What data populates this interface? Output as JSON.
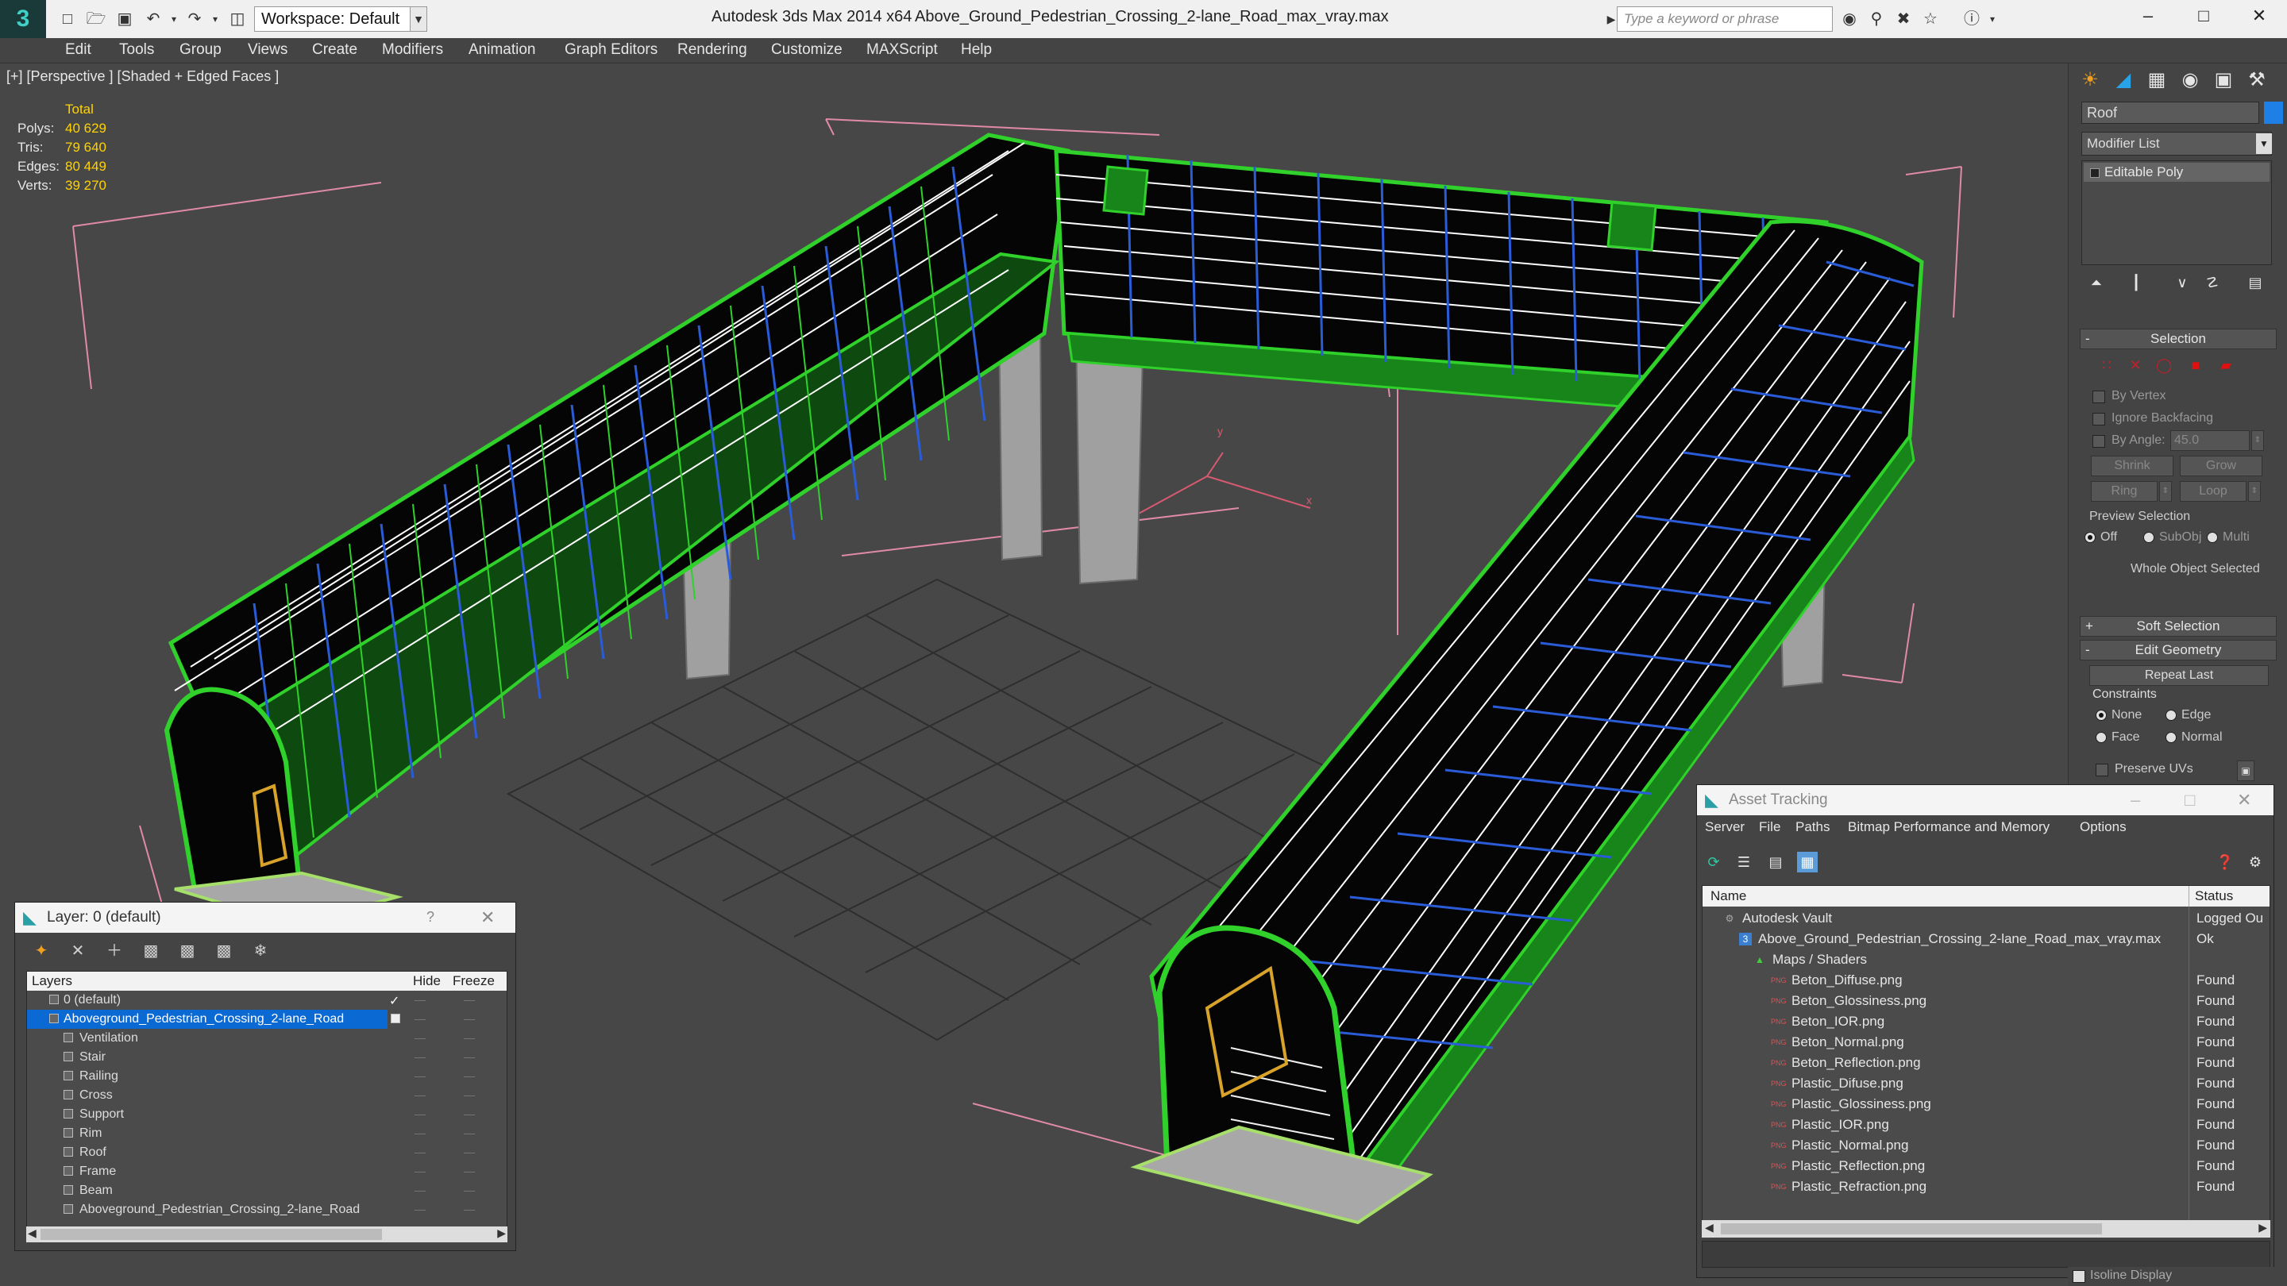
{
  "titlebar": {
    "app_title": "Autodesk 3ds Max 2014 x64",
    "file_title": "Above_Ground_Pedestrian_Crossing_2-lane_Road_max_vray.max",
    "workspace_label": "Workspace: Default",
    "search_placeholder": "Type a keyword or phrase"
  },
  "menu": [
    "Edit",
    "Tools",
    "Group",
    "Views",
    "Create",
    "Modifiers",
    "Animation",
    "Graph Editors",
    "Rendering",
    "Customize",
    "MAXScript",
    "Help"
  ],
  "viewport": {
    "label": "[+] [Perspective ] [Shaded + Edged Faces ]",
    "stats": {
      "total_label": "Total",
      "rows": [
        {
          "key": "Polys:",
          "value": "40 629"
        },
        {
          "key": "Tris:",
          "value": "79 640"
        },
        {
          "key": "Edges:",
          "value": "80 449"
        },
        {
          "key": "Verts:",
          "value": "39 270"
        }
      ]
    },
    "axis": {
      "x": "x",
      "y": "y"
    }
  },
  "command_panel": {
    "object_name": "Roof",
    "object_color": "#1e7fe6",
    "modifier_list": "Modifier List",
    "modifier_stack": [
      "Editable Poly"
    ],
    "selection": {
      "title": "Selection",
      "by_vertex": "By Vertex",
      "ignore_backfacing": "Ignore Backfacing",
      "by_angle": "By Angle:",
      "angle_value": "45.0",
      "shrink": "Shrink",
      "grow": "Grow",
      "ring": "Ring",
      "loop": "Loop",
      "preview_title": "Preview Selection",
      "preview_off": "Off",
      "preview_subobj": "SubObj",
      "preview_multi": "Multi",
      "status": "Whole Object Selected"
    },
    "soft_selection": "Soft Selection",
    "edit_geometry": {
      "title": "Edit Geometry",
      "repeat_last": "Repeat Last",
      "constraints": "Constraints",
      "none": "None",
      "edge": "Edge",
      "face": "Face",
      "normal": "Normal",
      "preserve_uvs": "Preserve UVs"
    },
    "isoline": "Isoline Display"
  },
  "layer_window": {
    "title": "Layer: 0 (default)",
    "help": "?",
    "columns": [
      "Layers",
      "Hide",
      "Freeze"
    ],
    "rows": [
      {
        "name": "0 (default)",
        "level": 0
      },
      {
        "name": "Aboveground_Pedestrian_Crossing_2-lane_Road",
        "level": 0
      },
      {
        "name": "Ventilation",
        "level": 1
      },
      {
        "name": "Stair",
        "level": 1
      },
      {
        "name": "Railing",
        "level": 1
      },
      {
        "name": "Cross",
        "level": 1
      },
      {
        "name": "Support",
        "level": 1
      },
      {
        "name": "Rim",
        "level": 1
      },
      {
        "name": "Roof",
        "level": 1
      },
      {
        "name": "Frame",
        "level": 1
      },
      {
        "name": "Beam",
        "level": 1
      },
      {
        "name": "Aboveground_Pedestrian_Crossing_2-lane_Road",
        "level": 1
      }
    ],
    "hide_mark": "—",
    "freeze_mark": "—"
  },
  "asset_window": {
    "title": "Asset Tracking",
    "menu": [
      "Server",
      "File",
      "Paths",
      "Bitmap Performance and Memory",
      "Options"
    ],
    "columns": [
      "Name",
      "Status"
    ],
    "rows": [
      {
        "name": "Autodesk Vault",
        "status": "Logged Ou",
        "level": 0
      },
      {
        "name": "Above_Ground_Pedestrian_Crossing_2-lane_Road_max_vray.max",
        "status": "Ok",
        "level": 1
      },
      {
        "name": "Maps / Shaders",
        "status": "",
        "level": 2
      },
      {
        "name": "Beton_Diffuse.png",
        "status": "Found",
        "level": 3
      },
      {
        "name": "Beton_Glossiness.png",
        "status": "Found",
        "level": 3
      },
      {
        "name": "Beton_IOR.png",
        "status": "Found",
        "level": 3
      },
      {
        "name": "Beton_Normal.png",
        "status": "Found",
        "level": 3
      },
      {
        "name": "Beton_Reflection.png",
        "status": "Found",
        "level": 3
      },
      {
        "name": "Plastic_Difuse.png",
        "status": "Found",
        "level": 3
      },
      {
        "name": "Plastic_Glossiness.png",
        "status": "Found",
        "level": 3
      },
      {
        "name": "Plastic_IOR.png",
        "status": "Found",
        "level": 3
      },
      {
        "name": "Plastic_Normal.png",
        "status": "Found",
        "level": 3
      },
      {
        "name": "Plastic_Reflection.png",
        "status": "Found",
        "level": 3
      },
      {
        "name": "Plastic_Refraction.png",
        "status": "Found",
        "level": 3
      }
    ],
    "png_badge": "PNG"
  },
  "colors": {
    "selection_blue": "#0b69d4",
    "stats_yellow": "#ffd200",
    "wire_green": "#2fd12a",
    "wire_blue": "#2a5cd8",
    "wire_white": "#ffffff"
  }
}
